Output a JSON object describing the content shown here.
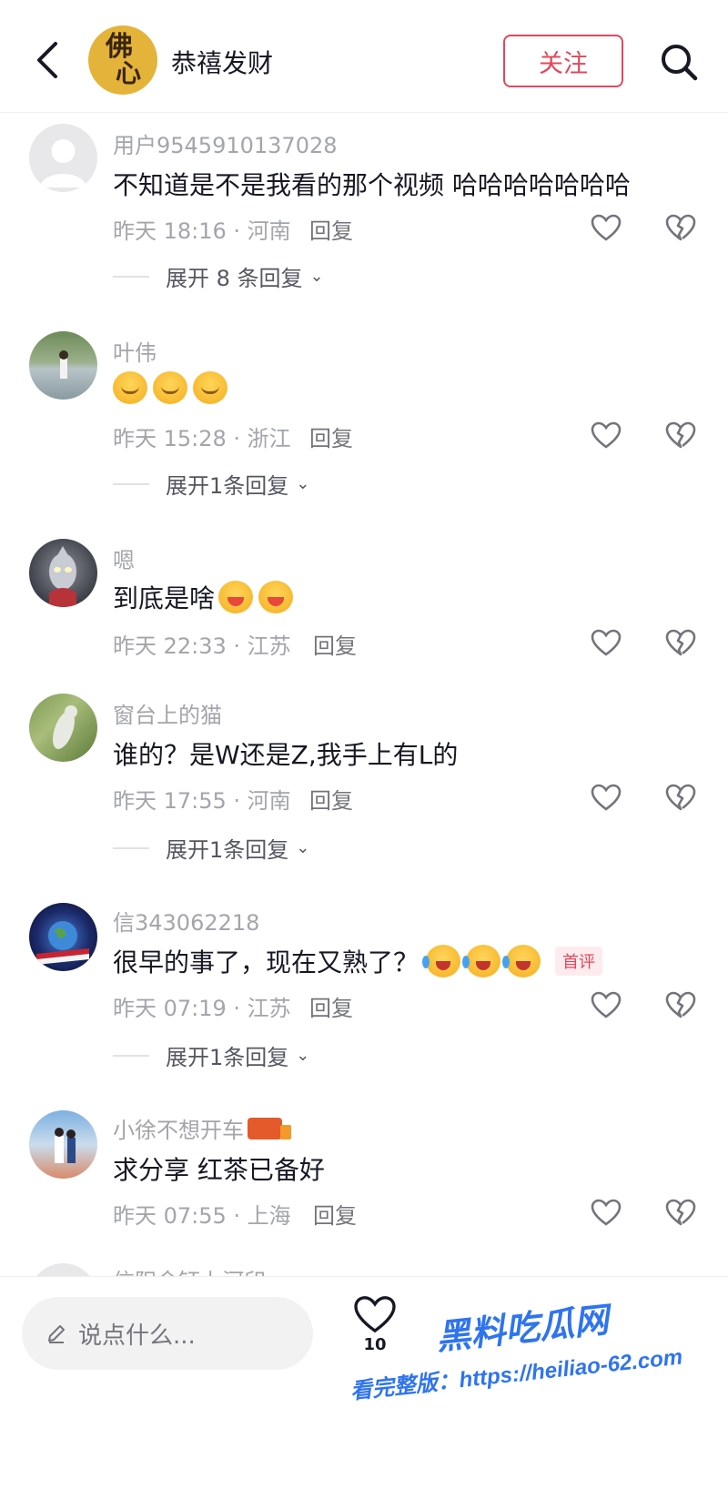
{
  "header": {
    "back_icon": "chevron-left-icon",
    "avatar_chars": [
      "佛",
      "心"
    ],
    "title": "恭禧发财",
    "follow_label": "关注",
    "search_icon": "search-icon",
    "accent_color": "#e0485c"
  },
  "comments": [
    {
      "user": "用户9545910137028",
      "text": "不知道是不是我看的那个视频  哈哈哈哈哈哈哈",
      "time_loc": "昨天 18:16 · 河南",
      "reply_label": "回复",
      "expand_label": "展开 8 条回复",
      "avatar": "default-avatar"
    },
    {
      "user": "叶伟",
      "text": "",
      "emojis": [
        "blush",
        "blush",
        "blush"
      ],
      "time_loc": "昨天 15:28 · 浙江",
      "reply_label": "回复",
      "expand_label": "展开1条回复",
      "avatar": "photo-avatar"
    },
    {
      "user": "嗯",
      "text": "到底是啥",
      "emojis": [
        "laugh",
        "laugh"
      ],
      "time_loc": "昨天 22:33 · 江苏",
      "reply_label": "回复",
      "avatar": "ultraman-avatar"
    },
    {
      "user": "窗台上的猫",
      "text": "谁的？是W还是Z,我手上有L的",
      "time_loc": "昨天 17:55 · 河南",
      "reply_label": "回复",
      "expand_label": "展开1条回复",
      "avatar": "photo-avatar"
    },
    {
      "user": "信343062218",
      "text": "很早的事了，现在又熟了？",
      "emojis": [
        "cry",
        "cry",
        "cry"
      ],
      "badge": "首评",
      "time_loc": "昨天 07:19 · 江苏",
      "reply_label": "回复",
      "expand_label": "展开1条回复",
      "avatar": "globe-avatar"
    },
    {
      "user": "小徐不想开车",
      "text": "求分享 红茶已备好",
      "time_loc": "昨天 07:55 · 上海",
      "reply_label": "回复",
      "avatar": "photo-avatar"
    }
  ],
  "partial_next_user": "信阳金钰上河印",
  "bottom": {
    "input_placeholder": "说点什么...",
    "like_count": "10"
  },
  "watermark": {
    "title": "黑料吃瓜网",
    "subtitle": "看完整版：https://heiliao-62.com"
  }
}
